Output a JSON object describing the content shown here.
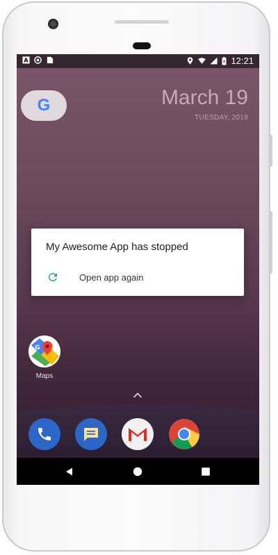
{
  "status_bar": {
    "time": "12:21",
    "left_icons": [
      "a-icon",
      "circle-icon",
      "sim-icon"
    ],
    "right_icons": [
      "location-icon",
      "wifi-icon",
      "signal-icon",
      "battery-icon"
    ]
  },
  "home": {
    "google_icon": "G",
    "date_big": "March 19",
    "date_small": "TUESDAY, 2019"
  },
  "dialog": {
    "title": "My Awesome App has stopped",
    "action_label": "Open app again",
    "accent": "#26a69a"
  },
  "apps": {
    "maps_label": "Maps"
  },
  "dock": {
    "icons": [
      "phone-icon",
      "messages-icon",
      "gmail-icon",
      "chrome-icon"
    ]
  },
  "nav": {
    "buttons": [
      "back-icon",
      "home-icon",
      "recents-icon"
    ]
  }
}
